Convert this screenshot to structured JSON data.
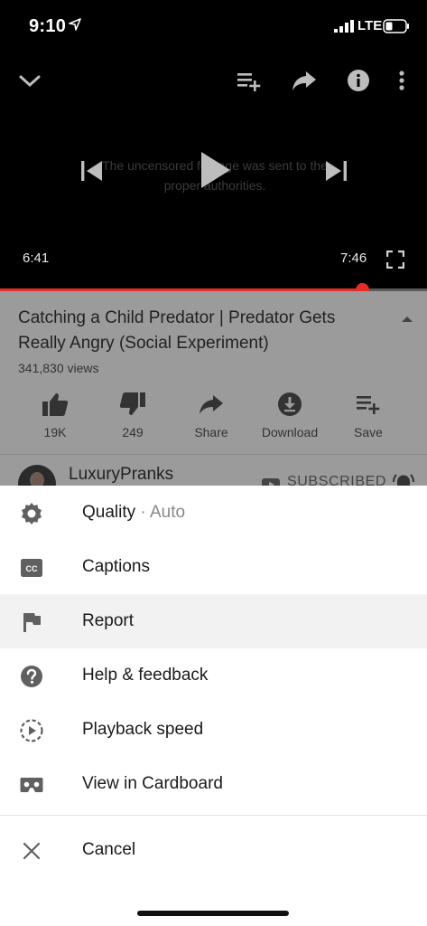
{
  "status_bar": {
    "time": "9:10",
    "network": "LTE"
  },
  "player": {
    "overlay_text": "The uncensored footage was sent to the proper authorities.",
    "current_time": "6:41",
    "total_time": "7:46",
    "progress": 0.848
  },
  "video": {
    "title": "Catching a Child Predator | Predator Gets Really Angry (Social Experiment)",
    "views": "341,830 views",
    "actions": [
      {
        "label": "19K",
        "icon": "thumbs-up-icon"
      },
      {
        "label": "249",
        "icon": "thumbs-down-icon"
      },
      {
        "label": "Share",
        "icon": "share-icon"
      },
      {
        "label": "Download",
        "icon": "download-icon"
      },
      {
        "label": "Save",
        "icon": "playlist-add-icon"
      }
    ]
  },
  "channel": {
    "name": "LuxuryPranks",
    "subscribe_label": "SUBSCRIBED"
  },
  "menu": {
    "items": [
      {
        "label": "Quality",
        "sub": " · Auto",
        "icon": "gear-icon"
      },
      {
        "label": "Captions",
        "icon": "captions-icon"
      },
      {
        "label": "Report",
        "icon": "flag-icon"
      },
      {
        "label": "Help & feedback",
        "icon": "help-icon"
      },
      {
        "label": "Playback speed",
        "icon": "playback-speed-icon"
      },
      {
        "label": "View in Cardboard",
        "icon": "cardboard-icon"
      }
    ],
    "cancel_label": "Cancel"
  },
  "colors": {
    "accent": "#e52d27",
    "dim_overlay": "#9b9b9b",
    "sheet_bg": "#ffffff"
  }
}
